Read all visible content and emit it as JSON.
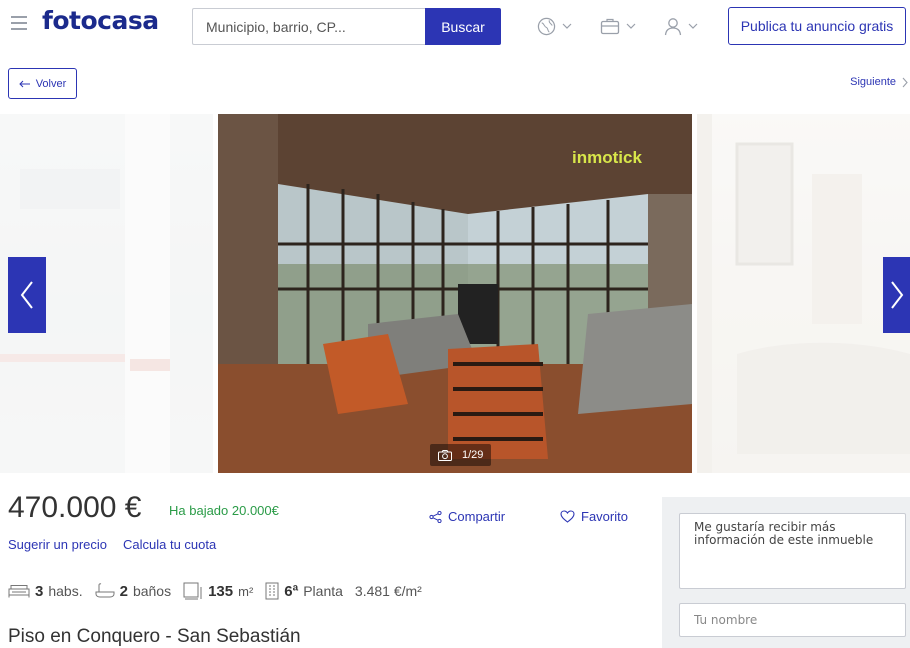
{
  "header": {
    "logo": "fotocasa",
    "search_placeholder": "Municipio, barrio, CP...",
    "search_button": "Buscar",
    "publish_button": "Publica tu anuncio gratis",
    "icons": [
      "globe-icon",
      "briefcase-icon",
      "user-icon"
    ]
  },
  "nav": {
    "back_label": "Volver",
    "next_label": "Siguiente"
  },
  "gallery": {
    "counter": "1/29",
    "watermark": "inmotick"
  },
  "listing": {
    "price": "470.000 €",
    "price_drop": "Ha bajado 20.000€",
    "share_label": "Compartir",
    "favorite_label": "Favorito",
    "suggest_price": "Sugerir un precio",
    "calculate_fee": "Calcula tu cuota",
    "features": {
      "rooms_value": "3",
      "rooms_unit": "habs.",
      "baths_value": "2",
      "baths_unit": "baños",
      "area_value": "135",
      "area_unit": "m²",
      "floor_value": "6ª",
      "floor_unit": "Planta",
      "price_per_m2": "3.481 €/m²"
    },
    "title": "Piso en Conquero - San Sebastián"
  },
  "contact": {
    "message": "Me gustaría recibir más información de este inmueble",
    "name_placeholder": "Tu nombre"
  },
  "colors": {
    "brand_blue": "#2c35b4",
    "logo_blue": "#1b2a8c",
    "price_drop_green": "#2a9b47"
  }
}
